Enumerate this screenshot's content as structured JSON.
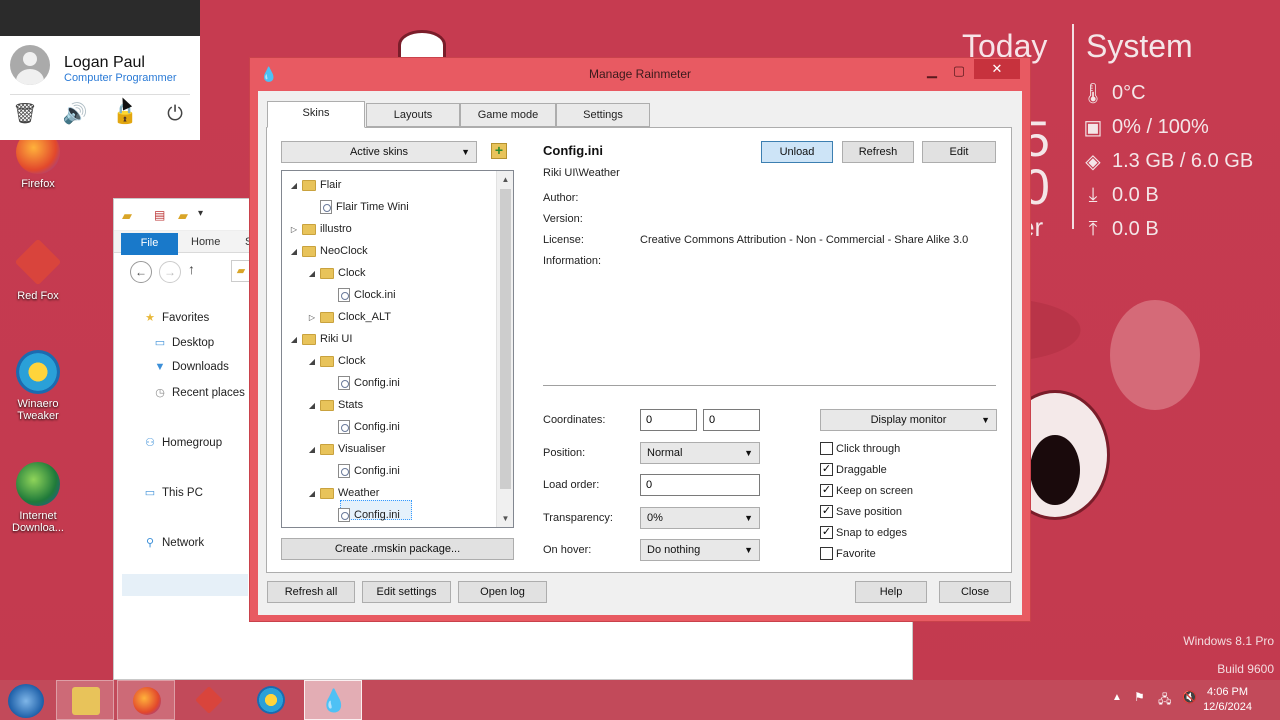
{
  "user_panel": {
    "name": "Logan Paul",
    "role": "Computer Programmer"
  },
  "desktop": {
    "icons": [
      "Firefox",
      "Red Fox",
      "Winaero Tweaker",
      "Internet Downloa..."
    ],
    "widget": {
      "today": "Today",
      "system": "System",
      "big_digit_1": "5",
      "big_digit_2": "0",
      "weather_partial": "er",
      "temp": "0°C",
      "cpu": "0% / 100%",
      "ram": "1.3 GB / 6.0 GB",
      "download": "0.0 B",
      "upload": "0.0 B"
    },
    "watermark": {
      "os": "Windows 8.1 Pro",
      "build": "Build 9600"
    }
  },
  "explorer": {
    "ribbon": {
      "file": "File",
      "home": "Home",
      "share_partial": "S"
    },
    "nav": {
      "favorites": "Favorites",
      "desktop": "Desktop",
      "downloads": "Downloads",
      "recent": "Recent places",
      "homegroup": "Homegroup",
      "this_pc": "This PC",
      "network": "Network"
    }
  },
  "rainmeter": {
    "title": "Manage Rainmeter",
    "tabs": [
      "Skins",
      "Layouts",
      "Game mode",
      "Settings"
    ],
    "active_skins": "Active skins",
    "tree": [
      {
        "label": "Flair",
        "type": "folder",
        "depth": 0,
        "exp": "◢"
      },
      {
        "label": "Flair Time Wini",
        "type": "file",
        "depth": 1,
        "exp": ""
      },
      {
        "label": "illustro",
        "type": "folder",
        "depth": 0,
        "exp": "▷"
      },
      {
        "label": "NeoClock",
        "type": "folder",
        "depth": 0,
        "exp": "◢"
      },
      {
        "label": "Clock",
        "type": "folder",
        "depth": 1,
        "exp": "◢"
      },
      {
        "label": "Clock.ini",
        "type": "file",
        "depth": 2,
        "exp": ""
      },
      {
        "label": "Clock_ALT",
        "type": "folder",
        "depth": 1,
        "exp": "▷"
      },
      {
        "label": "Riki UI",
        "type": "folder",
        "depth": 0,
        "exp": "◢"
      },
      {
        "label": "Clock",
        "type": "folder",
        "depth": 1,
        "exp": "◢"
      },
      {
        "label": "Config.ini",
        "type": "file",
        "depth": 2,
        "exp": ""
      },
      {
        "label": "Stats",
        "type": "folder",
        "depth": 1,
        "exp": "◢"
      },
      {
        "label": "Config.ini",
        "type": "file",
        "depth": 2,
        "exp": ""
      },
      {
        "label": "Visualiser",
        "type": "folder",
        "depth": 1,
        "exp": "◢"
      },
      {
        "label": "Config.ini",
        "type": "file",
        "depth": 2,
        "exp": ""
      },
      {
        "label": "Weather",
        "type": "folder",
        "depth": 1,
        "exp": "◢"
      },
      {
        "label": "Config.ini",
        "type": "file",
        "depth": 2,
        "exp": ""
      }
    ],
    "create_package": "Create .rmskin package...",
    "config": {
      "name": "Config.ini",
      "path": "Riki UI\\Weather",
      "author_label": "Author:",
      "version_label": "Version:",
      "license_label": "License:",
      "license_value": "Creative Commons Attribution - Non - Commercial - Share Alike 3.0",
      "info_label": "Information:"
    },
    "buttons": {
      "unload": "Unload",
      "refresh": "Refresh",
      "edit": "Edit"
    },
    "settings": {
      "coordinates_label": "Coordinates:",
      "coord_x": "0",
      "coord_y": "0",
      "position_label": "Position:",
      "position_value": "Normal",
      "load_order_label": "Load order:",
      "load_order_value": "0",
      "transparency_label": "Transparency:",
      "transparency_value": "0%",
      "on_hover_label": "On hover:",
      "on_hover_value": "Do nothing",
      "display_monitor": "Display monitor"
    },
    "checkboxes": [
      {
        "label": "Click through",
        "checked": false
      },
      {
        "label": "Draggable",
        "checked": true
      },
      {
        "label": "Keep on screen",
        "checked": true
      },
      {
        "label": "Save position",
        "checked": true
      },
      {
        "label": "Snap to edges",
        "checked": true
      },
      {
        "label": "Favorite",
        "checked": false
      }
    ],
    "footer": {
      "refresh_all": "Refresh all",
      "edit_settings": "Edit settings",
      "open_log": "Open log",
      "help": "Help",
      "close": "Close"
    }
  },
  "taskbar": {
    "time": "4:06 PM",
    "date": "12/6/2024"
  }
}
